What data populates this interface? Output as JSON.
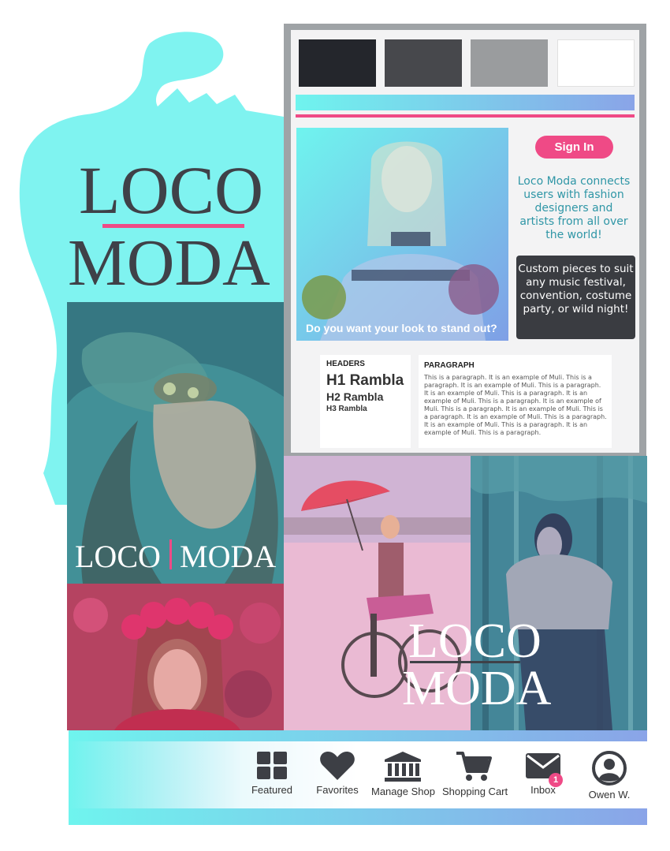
{
  "brand": {
    "line1": "LOCO",
    "line2": "MODA",
    "split_left": "LOCO",
    "split_right": "MODA"
  },
  "colors": {
    "accent_pink": "#ef4a86",
    "cyan": "#6ff4ee",
    "periwinkle": "#8aa4e8",
    "dark": "#24262c",
    "charcoal": "#47484c",
    "gray": "#9a9c9e",
    "white": "#ffffff",
    "teal_text": "#2f96a6"
  },
  "guide": {
    "signin_label": "Sign In",
    "tagline": "Loco Moda connects users with fashion designers and artists from all over the world!",
    "custom": "Custom pieces to suit any music festival, convention, costume party, or wild night!",
    "hero_caption": "Do you want your look to stand out?",
    "headers_title": "HEADERS",
    "h1": "H1 Rambla",
    "h2": "H2 Rambla",
    "h3": "H3 Rambla",
    "paragraph_title": "PARAGRAPH",
    "paragraph": "This is a paragraph.  It is an example of Muli.  This is a paragraph.  It is an example of Muli.  This is a paragraph.  It is an example of Muli.  This is a paragraph.  It is an example of Muli.  This is a paragraph.  It is an example of Muli.  This is a paragraph.  It is an example of Muli.  This is a paragraph.  It is an example of Muli.  This is a paragraph.  It is an example of Muli.  This is a paragraph.  It is an example of Muli.  This is a paragraph."
  },
  "nav": {
    "items": [
      {
        "label": "Featured",
        "icon": "grid-icon"
      },
      {
        "label": "Favorites",
        "icon": "heart-icon"
      },
      {
        "label": "Manage Shop",
        "icon": "bank-icon"
      },
      {
        "label": "Shopping Cart",
        "icon": "cart-icon"
      },
      {
        "label": "Inbox",
        "icon": "mail-icon"
      },
      {
        "label": "Owen W.",
        "icon": "user-icon"
      }
    ],
    "inbox_badge": "1"
  }
}
